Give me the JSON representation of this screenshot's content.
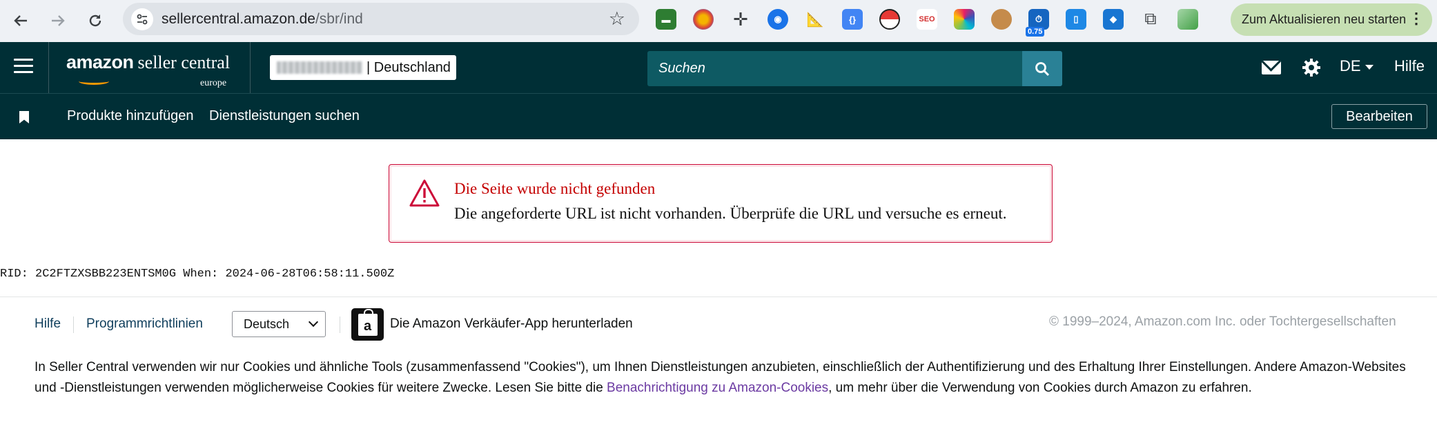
{
  "browser": {
    "url_host": "sellercentral.amazon.de",
    "url_path": "/sbr/ind",
    "update_button_label": "Zum Aktualisieren neu starten",
    "extension_badge": "0.75"
  },
  "header": {
    "logo_brand": "amazon",
    "logo_product": "seller central",
    "logo_region": "europe",
    "account_marketplace": "| Deutschland",
    "search_placeholder": "Suchen",
    "language": "DE",
    "help_label": "Hilfe"
  },
  "subnav": {
    "items": [
      {
        "label": "Produkte hinzufügen"
      },
      {
        "label": "Dienstleistungen suchen"
      }
    ],
    "edit_label": "Bearbeiten"
  },
  "alert": {
    "title": "Die Seite wurde nicht gefunden",
    "message": "Die angeforderte URL ist nicht vorhanden. Überprüfe die URL und versuche es erneut."
  },
  "rid_line": "RID: 2C2FTZXSBB223ENTSM0G When: 2024-06-28T06:58:11.500Z",
  "footer": {
    "help_link": "Hilfe",
    "policies_link": "Programmrichtlinien",
    "language_selected": "Deutsch",
    "app_link": "Die Amazon Verkäufer-App herunterladen",
    "copyright": "© 1999–2024, Amazon.com Inc. oder Tochtergesellschaften",
    "cookie_text_before": "In Seller Central verwenden wir nur Cookies und ähnliche Tools (zusammenfassend \"Cookies\"), um Ihnen Dienstleistungen anzubieten, einschließlich der Authentifizierung und des Erhaltung Ihrer Einstellungen. Andere Amazon-Websites und -Dienstleistungen verwenden möglicherweise Cookies für weitere Zwecke. Lesen Sie bitte die ",
    "cookie_link": "Benachrichtigung zu Amazon-Cookies",
    "cookie_text_after": ", um mehr über die Verwendung von Cookies durch Amazon zu erfahren."
  },
  "colors": {
    "header_bg": "#002f36",
    "search_button": "#2a8196",
    "alert_red": "#cc0c39",
    "link_purple": "#6b3aa2"
  }
}
